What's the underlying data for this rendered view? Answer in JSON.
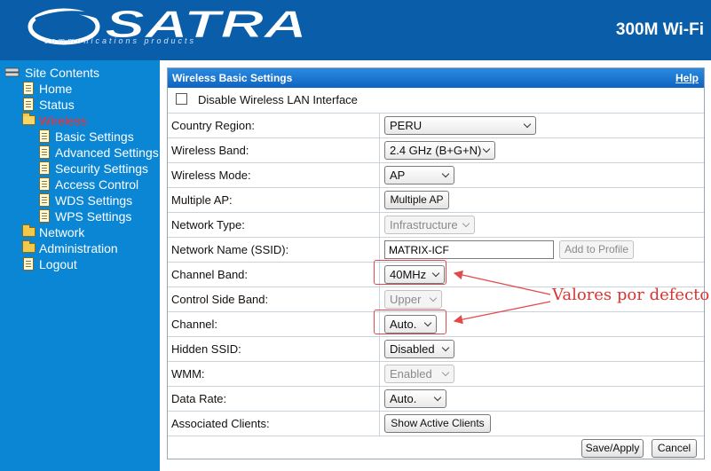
{
  "header": {
    "brand_name": "SATRA",
    "brand_tagline": "communications products",
    "model": "300M Wi-Fi"
  },
  "sidebar": {
    "root": "Site Contents",
    "items": [
      {
        "label": "Home",
        "icon": "document-icon"
      },
      {
        "label": "Status",
        "icon": "document-icon"
      },
      {
        "label": "Wireless",
        "icon": "folder-open-icon",
        "active": true
      },
      {
        "label": "Basic Settings",
        "icon": "document-icon"
      },
      {
        "label": "Advanced Settings",
        "icon": "document-icon"
      },
      {
        "label": "Security Settings",
        "icon": "document-icon"
      },
      {
        "label": "Access Control",
        "icon": "document-icon"
      },
      {
        "label": "WDS Settings",
        "icon": "document-icon"
      },
      {
        "label": "WPS Settings",
        "icon": "document-icon"
      },
      {
        "label": "Network",
        "icon": "folder-icon"
      },
      {
        "label": "Administration",
        "icon": "folder-icon"
      },
      {
        "label": "Logout",
        "icon": "document-icon"
      }
    ]
  },
  "panel": {
    "title": "Wireless Basic Settings",
    "help": "Help",
    "disable_wlan_label": "Disable Wireless LAN Interface",
    "disable_wlan_checked": false,
    "rows": {
      "country_region": {
        "label": "Country Region:",
        "value": "PERU"
      },
      "wireless_band": {
        "label": "Wireless Band:",
        "value": "2.4 GHz (B+G+N)"
      },
      "wireless_mode": {
        "label": "Wireless Mode:",
        "value": "AP"
      },
      "multiple_ap": {
        "label": "Multiple AP:",
        "button": "Multiple AP"
      },
      "network_type": {
        "label": "Network Type:",
        "value": "Infrastructure"
      },
      "ssid": {
        "label": "Network Name (SSID):",
        "value": "MATRIX-ICF",
        "button": "Add to Profile"
      },
      "channel_band": {
        "label": "Channel Band:",
        "value": "40MHz"
      },
      "control_side_band": {
        "label": "Control Side Band:",
        "value": "Upper"
      },
      "channel": {
        "label": "Channel:",
        "value": "Auto."
      },
      "hidden_ssid": {
        "label": "Hidden SSID:",
        "value": "Disabled"
      },
      "wmm": {
        "label": "WMM:",
        "value": "Enabled"
      },
      "data_rate": {
        "label": "Data Rate:",
        "value": "Auto."
      },
      "associated_clients": {
        "label": "Associated Clients:",
        "button": "Show Active Clients"
      }
    },
    "save_button": "Save/Apply",
    "cancel_button": "Cancel"
  },
  "annotation": {
    "text": "Valores por defecto",
    "color": "#d93434"
  },
  "colors": {
    "header_bg": "#0a5ea9",
    "sidebar_bg": "#0a86d4",
    "title_bar": "#1a72cc",
    "active_item": "#ff2a2a"
  }
}
